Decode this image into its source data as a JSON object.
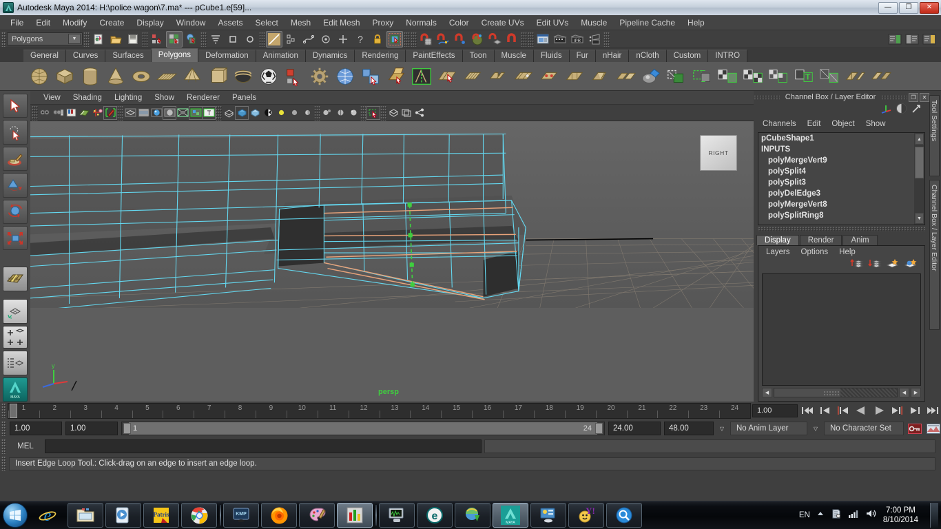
{
  "window": {
    "title": "Autodesk Maya 2014: H:\\police wagon\\7.ma*   ---   pCube1.e[59]...",
    "minimize": "—",
    "maximize": "❐",
    "close": "✕"
  },
  "menubar": {
    "items": [
      "File",
      "Edit",
      "Modify",
      "Create",
      "Display",
      "Window",
      "Assets",
      "Select",
      "Mesh",
      "Edit Mesh",
      "Proxy",
      "Normals",
      "Color",
      "Create UVs",
      "Edit UVs",
      "Muscle",
      "Pipeline Cache",
      "Help"
    ]
  },
  "statusline": {
    "menuset": "Polygons",
    "icons": [
      "new-scene-icon",
      "open-scene-icon",
      "save-scene-icon",
      "select-by-hierarchy-icon",
      "select-by-object-type-icon",
      "select-by-component-type-icon",
      "highlight-selection-mode-icon",
      "select-all-dag-objects-icon",
      "select-nothing-icon",
      "paint-select-icon",
      "select-by-hierarchy-leaf-icon",
      "select-curve-icon",
      "select-point-icon",
      "select-center-icon",
      "question-icon",
      "lock-selection-icon",
      "soft-select-icon",
      "snap-to-grid-icon",
      "snap-to-curve-icon",
      "snap-to-point-icon",
      "snap-to-projected-center-icon",
      "snap-to-view-plane-icon",
      "make-live-icon",
      "show-render-view-icon",
      "render-current-frame-icon",
      "ipr-render-icon",
      "render-settings-icon"
    ]
  },
  "shelf": {
    "tabs": [
      "General",
      "Curves",
      "Surfaces",
      "Polygons",
      "Deformation",
      "Animation",
      "Dynamics",
      "Rendering",
      "PaintEffects",
      "Toon",
      "Muscle",
      "Fluids",
      "Fur",
      "nHair",
      "nCloth",
      "Custom",
      "INTRO"
    ],
    "selected_tab": "Polygons",
    "icons": [
      "poly-sphere-icon",
      "poly-cube-icon",
      "poly-cylinder-icon",
      "poly-cone-icon",
      "poly-torus-icon",
      "poly-plane-icon",
      "poly-pyramid-icon",
      "poly-prism-icon",
      "poly-helix-icon",
      "poly-soccer-ball-icon",
      "poly-platonic-icon",
      "poly-gear-icon",
      "poly-sphere-uv-icon",
      "poly-combine-icon",
      "poly-extrude-icon",
      "insert-edge-loop-icon",
      "cut-faces-icon",
      "poly-bevel-icon",
      "poly-bridge-icon",
      "poly-append-icon",
      "poly-merge-icon",
      "poly-collapse-icon",
      "poly-wedge-icon",
      "poly-duplicate-face-icon",
      "poly-smooth-icon",
      "poly-booleans-icon",
      "poly-mirror-icon",
      "poly-reduce-icon",
      "poly-triangulate-icon",
      "poly-quadrangulate-icon",
      "poly-transfer-icon",
      "poly-normals-icon",
      "poly-crease-icon",
      "poly-sculpt-icon"
    ]
  },
  "toolbox": {
    "tools": [
      "select-tool",
      "lasso-select-tool",
      "paint-select-tool",
      "move-tool",
      "rotate-tool",
      "scale-tool",
      "last-tool-used",
      "single-perspective-view-layout",
      "four-view-layout",
      "persp-outliner-layout",
      "maya-logo"
    ]
  },
  "viewport": {
    "menu": [
      "View",
      "Shading",
      "Lighting",
      "Show",
      "Renderer",
      "Panels"
    ],
    "toolbar_icons": [
      "select-camera-icon",
      "camera-attributes-icon",
      "bookmarks-icon",
      "image-plane-icon",
      "two-d-pan-zoom-icon",
      "grease-pencil-icon",
      "wireframe-icon",
      "smooth-shade-icon",
      "shaded-textured-icon",
      "use-all-lights-icon",
      "shadows-icon",
      "xray-icon",
      "xray-joints-icon",
      "text-icon",
      "isolate-select-icon",
      "wireframe-mode-icon",
      "smooth-shade-all-icon",
      "smooth-shade-textured-icon",
      "use-default-light-icon",
      "use-all-lights-2-icon",
      "shadow-icon",
      "screen-space-ao-icon",
      "motion-blur-icon",
      "multisample-icon",
      "depth-peeling-icon",
      "grid-toggle-icon",
      "film-gate-icon",
      "share-icon"
    ],
    "camera_label": "persp",
    "view_cube_label": "RIGHT",
    "axis_y": "y",
    "axis_x": "x",
    "axis_z": "z"
  },
  "channelbox": {
    "panel_title": "Channel Box / Layer Editor",
    "restore_btn": "❐",
    "close_btn": "✕",
    "header_icons": [
      "show-manipulator-icon",
      "channel-box-icon",
      "attribute-editor-icon"
    ],
    "menu": [
      "Channels",
      "Edit",
      "Object",
      "Show"
    ],
    "node_name": "pCubeShape1",
    "inputs_label": "INPUTS",
    "inputs": [
      "polyMergeVert9",
      "polySplit4",
      "polySplit3",
      "polyDelEdge3",
      "polyMergeVert8",
      "polySplitRing8"
    ],
    "scroll_up": "▲",
    "scroll_down": "▼"
  },
  "layer_editor": {
    "tabs": [
      "Display",
      "Render",
      "Anim"
    ],
    "selected_tab": "Display",
    "menu": [
      "Layers",
      "Options",
      "Help"
    ],
    "icons": [
      "move-layer-up-icon",
      "move-layer-down-icon",
      "new-empty-layer-icon",
      "new-layer-from-selected-icon"
    ],
    "scroll_left": "◀",
    "scroll_right": "▶"
  },
  "side_tabs": [
    "Tool Settings",
    "Channel Box / Layer Editor"
  ],
  "timeline": {
    "ticks": [
      1,
      2,
      3,
      4,
      5,
      6,
      7,
      8,
      9,
      10,
      11,
      12,
      13,
      14,
      15,
      16,
      17,
      18,
      19,
      20,
      21,
      22,
      23,
      24
    ],
    "current_frame_field": "1.00",
    "playback_buttons": [
      "go-to-start-icon",
      "step-back-frame-icon",
      "step-back-key-icon",
      "play-backwards-icon",
      "play-forwards-icon",
      "step-forward-key-icon",
      "step-forward-frame-icon",
      "go-to-end-icon"
    ]
  },
  "range_slider": {
    "anim_start": "1.00",
    "playback_start": "1.00",
    "range_start_label": "1",
    "range_end_label": "24",
    "playback_end": "24.00",
    "anim_end": "48.00",
    "anim_layer": "No Anim Layer",
    "character_set": "No Character Set",
    "auto_key_icon": "auto-keyframe-icon",
    "anim_prefs_icon": "animation-preferences-icon",
    "dropdown_arrow": "▽"
  },
  "command_line": {
    "language_label": "MEL",
    "input_value": "",
    "input_placeholder": ""
  },
  "help_line": {
    "text": "Insert Edge Loop Tool.: Click-drag on an edge to insert an edge loop."
  },
  "taskbar": {
    "start_icon": "windows-start-orb-icon",
    "pinned": [
      "internet-explorer-icon",
      "windows-explorer-icon",
      "windows-media-player-icon",
      "patris-icon",
      "google-chrome-icon"
    ],
    "running": [
      "kmplayer-icon",
      "mozilla-firefox-icon",
      "ms-paint-icon",
      "chart-app-icon",
      "system-monitor-icon",
      "teal-e-app-icon",
      "internet-download-manager-icon",
      "autodesk-maya-icon",
      "control-panel-icon",
      "yahoo-messenger-icon",
      "everything-search-icon"
    ],
    "active_item": "autodesk-maya-icon",
    "language": "EN",
    "tray_icons": [
      "show-hidden-icons-icon",
      "action-center-icon",
      "network-icon",
      "volume-icon"
    ],
    "time": "7:00 PM",
    "date": "8/10/2014"
  },
  "colors": {
    "wireframe": "#64d8f0",
    "selected_edge": "#e8a37a",
    "active_edge": "#3fcf3f",
    "grid": "#8a8074",
    "mesh_fill": "#4a4a4a",
    "maya_bg": "#3f3f3f",
    "viewport_bg": "#5e5e5e"
  }
}
